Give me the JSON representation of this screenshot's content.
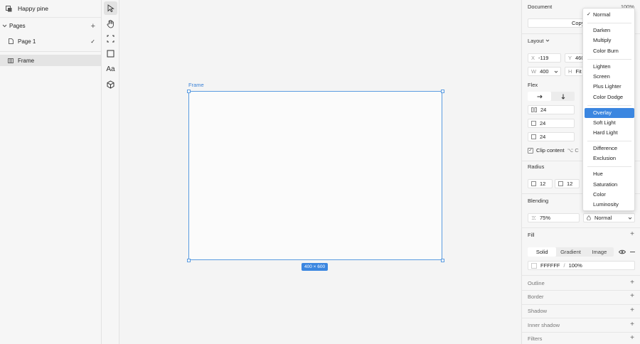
{
  "app": {
    "document_name": "Happy pine"
  },
  "sidebar": {
    "pages_label": "Pages",
    "pages": [
      {
        "label": "Page 1"
      }
    ],
    "layers": [
      {
        "label": "Frame"
      }
    ]
  },
  "tools": [
    "select-tool",
    "hand-tool",
    "frame-tool",
    "rectangle-tool",
    "text-tool",
    "component-tool"
  ],
  "tool_labels": {
    "text": "Aa"
  },
  "canvas": {
    "frame_label": "Frame",
    "size_badge": "400 × 600"
  },
  "panel": {
    "document_label": "Document",
    "zoom": "100%",
    "copy_link_label": "Copy lin",
    "layout_label": "Layout",
    "x_label": "X",
    "x_value": "-119",
    "y_label": "Y",
    "y_value": "460",
    "w_label": "W",
    "w_value": "400",
    "h_label": "H",
    "h_value": "Fit",
    "flex_label": "Flex",
    "gap_value": "24",
    "pad_value_1": "24",
    "pad_value_2": "24",
    "clip_content_label": "Clip content",
    "clip_shortcut": "⌥ C",
    "radius_label": "Radius",
    "radius_1": "12",
    "radius_2": "12",
    "blending_label": "Blending",
    "opacity": "75%",
    "blend_mode": "Normal",
    "fill_label": "Fill",
    "fill_tabs": [
      "Solid",
      "Gradient",
      "Image"
    ],
    "fill_hex": "FFFFFF",
    "fill_sep": "/",
    "fill_opacity": "100%",
    "outline_label": "Outline",
    "border_label": "Border",
    "shadow_label": "Shadow",
    "inner_shadow_label": "Inner shadow",
    "filters_label": "Filters"
  },
  "blend_menu": {
    "items": [
      "Normal",
      "Darken",
      "Multiply",
      "Color Burn",
      "Lighten",
      "Screen",
      "Plus Lighter",
      "Color Dodge",
      "Overlay",
      "Soft Light",
      "Hard Light",
      "Difference",
      "Exclusion",
      "Hue",
      "Saturation",
      "Color",
      "Luminosity"
    ],
    "checked": "Normal",
    "highlighted": "Overlay"
  },
  "colors": {
    "accent": "#3b86e0",
    "frame_border": "#5a9be0"
  }
}
